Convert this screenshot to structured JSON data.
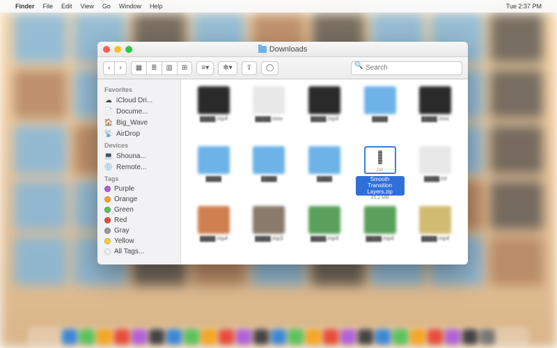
{
  "menubar": {
    "app": "Finder",
    "items": [
      "File",
      "Edit",
      "View",
      "Go",
      "Window",
      "Help"
    ],
    "clock": "Tue 2:37 PM"
  },
  "window": {
    "title": "Downloads"
  },
  "toolbar": {
    "back": "‹",
    "forward": "›",
    "views": [
      "▦",
      "≣",
      "▥",
      "⊞"
    ],
    "arrange": "≡▾",
    "action": "✻▾",
    "share": "⇪",
    "tags": "◯",
    "search_placeholder": "Search"
  },
  "sidebar": {
    "favorites_label": "Favorites",
    "favorites": [
      {
        "icon": "☁",
        "label": "iCloud Dri..."
      },
      {
        "icon": "📄",
        "label": "Docume..."
      },
      {
        "icon": "🏠",
        "label": "Big_Wave"
      },
      {
        "icon": "📡",
        "label": "AirDrop"
      }
    ],
    "devices_label": "Devices",
    "devices": [
      {
        "icon": "💻",
        "label": "Shouna..."
      },
      {
        "icon": "💿",
        "label": "Remote..."
      }
    ],
    "tags_label": "Tags",
    "tags": [
      {
        "color": "#b060d8",
        "label": "Purple"
      },
      {
        "color": "#f5a623",
        "label": "Orange"
      },
      {
        "color": "#5ac35a",
        "label": "Green"
      },
      {
        "color": "#e74c3c",
        "label": "Red"
      },
      {
        "color": "#9a9a9a",
        "label": "Gray"
      },
      {
        "color": "#f2d43a",
        "label": "Yellow"
      },
      {
        "color": "transparent",
        "label": "All Tags..."
      }
    ]
  },
  "files": [
    {
      "thumb": "#2a2a2a",
      "name": "████.mp4",
      "size": ""
    },
    {
      "thumb": "#e8e8e8",
      "name": "████.mov",
      "size": ""
    },
    {
      "thumb": "#2a2a2a",
      "name": "████.mp4",
      "size": ""
    },
    {
      "thumb": "#6db3e8",
      "name": "████",
      "size": ""
    },
    {
      "thumb": "#2a2a2a",
      "name": "████.mov",
      "size": ""
    },
    {
      "thumb": "#6db3e8",
      "name": "████",
      "size": ""
    },
    {
      "thumb": "#6db3e8",
      "name": "████",
      "size": ""
    },
    {
      "thumb": "#6db3e8",
      "name": "████",
      "size": ""
    },
    {
      "thumb": "zip",
      "name": "Smooth Transition Layers.zip",
      "size": "35.2 MB",
      "selected": true
    },
    {
      "thumb": "#e8e8e8",
      "name": "████.txt",
      "size": ""
    },
    {
      "thumb": "#d08050",
      "name": "████.mp4",
      "size": ""
    },
    {
      "thumb": "#8a7a6a",
      "name": "████.mp3",
      "size": ""
    },
    {
      "thumb": "#5aa05a",
      "name": "████.mp4",
      "size": ""
    },
    {
      "thumb": "#5aa05a",
      "name": "████.mp4",
      "size": ""
    },
    {
      "thumb": "#d0bb70",
      "name": "████.mp4",
      "size": ""
    }
  ],
  "dock_colors": [
    "#3a88d8",
    "#5ac35a",
    "#f5a623",
    "#e74c3c",
    "#b060d8",
    "#444",
    "#3a88d8",
    "#5ac35a",
    "#f5a623",
    "#e74c3c",
    "#b060d8",
    "#444",
    "#3a88d8",
    "#5ac35a",
    "#f5a623",
    "#e74c3c",
    "#b060d8",
    "#444",
    "#3a88d8",
    "#5ac35a",
    "#f5a623",
    "#e74c3c",
    "#b060d8",
    "#444",
    "#777"
  ]
}
